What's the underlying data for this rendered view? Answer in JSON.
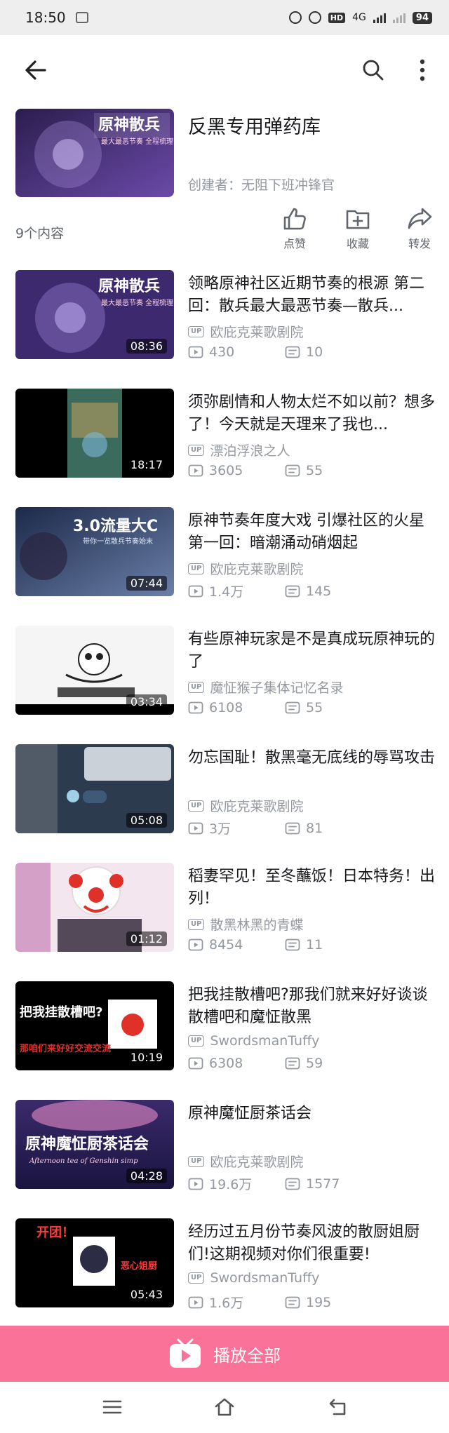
{
  "status_bar": {
    "time": "18:50",
    "network": "4G",
    "battery": "94",
    "hd": "HD"
  },
  "nav": {
    "back_icon": "back-arrow-icon",
    "search_icon": "search-icon",
    "more_icon": "more-vertical-icon"
  },
  "collection": {
    "title": "反黑专用弹药库",
    "creator": "创建者：无阻下班冲锋官",
    "count": "9个内容"
  },
  "actions": [
    {
      "label": "点赞",
      "icon": "like-icon"
    },
    {
      "label": "收藏",
      "icon": "favorite-icon"
    },
    {
      "label": "转发",
      "icon": "share-icon"
    }
  ],
  "videos": [
    {
      "title": "领略原神社区近期节奏的根源 第二回：散兵最大最恶节奏—散兵...",
      "uploader": "欧庇克莱歌剧院",
      "views": "430",
      "danmaku": "10",
      "duration": "08:36"
    },
    {
      "title": "须弥剧情和人物太烂不如以前？想多了！今天就是天理来了我也...",
      "uploader": "漂泊浮浪之人",
      "views": "3605",
      "danmaku": "55",
      "duration": "18:17"
    },
    {
      "title": "原神节奏年度大戏  引爆社区的火星  第一回：暗潮涌动硝烟起",
      "uploader": "欧庇克莱歌剧院",
      "views": "1.4万",
      "danmaku": "145",
      "duration": "07:44"
    },
    {
      "title": "有些原神玩家是不是真成玩原神玩的了",
      "uploader": "魔怔猴子集体记忆名录",
      "views": "6108",
      "danmaku": "55",
      "duration": "03:34"
    },
    {
      "title": "勿忘国耻！散黑毫无底线的辱骂攻击",
      "uploader": "欧庇克莱歌剧院",
      "views": "3万",
      "danmaku": "81",
      "duration": "05:08"
    },
    {
      "title": "稻妻罕见！至冬蘸饭！日本特务！出列！",
      "uploader": "散黑林黑的青蝶",
      "views": "8454",
      "danmaku": "11",
      "duration": "01:12"
    },
    {
      "title": "把我挂散槽吧?那我们就来好好谈谈散槽吧和魔怔散黑",
      "uploader": "SwordsmanTuffy",
      "views": "6308",
      "danmaku": "59",
      "duration": "10:19"
    },
    {
      "title": "原神魔怔厨茶话会",
      "uploader": "欧庇克莱歌剧院",
      "views": "19.6万",
      "danmaku": "1577",
      "duration": "04:28"
    },
    {
      "title": "经历过五月份节奏风波的散厨姐厨们!这期视频对你们很重要!",
      "uploader": "SwordsmanTuffy",
      "views": "1.6万",
      "danmaku": "195",
      "duration": "05:43"
    }
  ],
  "up_badge": "UP",
  "thumb_texts": {
    "cover_top": "原神散兵",
    "cover_sub": "最大最恶节奏 全程梳理",
    "t3": "3.0流量大C",
    "t3_sub": "带你一览散兵节奏始末",
    "t7": "把我挂散槽吧?",
    "t7_sub": "那咱们来好好交流交流",
    "t8": "原神魔怔厨茶话会",
    "t8_sub": "Afternoon tea of Genshin simp",
    "t9": "开团！",
    "t9_sub": "恶心姐厨"
  },
  "play_all": {
    "label": "播放全部",
    "icon": "play-icon"
  },
  "system_nav": {
    "menu": "menu-icon",
    "home": "home-icon",
    "back": "back-icon"
  },
  "colors": {
    "accent": "#fb7299",
    "muted": "#9499a0",
    "text": "#18191c"
  }
}
